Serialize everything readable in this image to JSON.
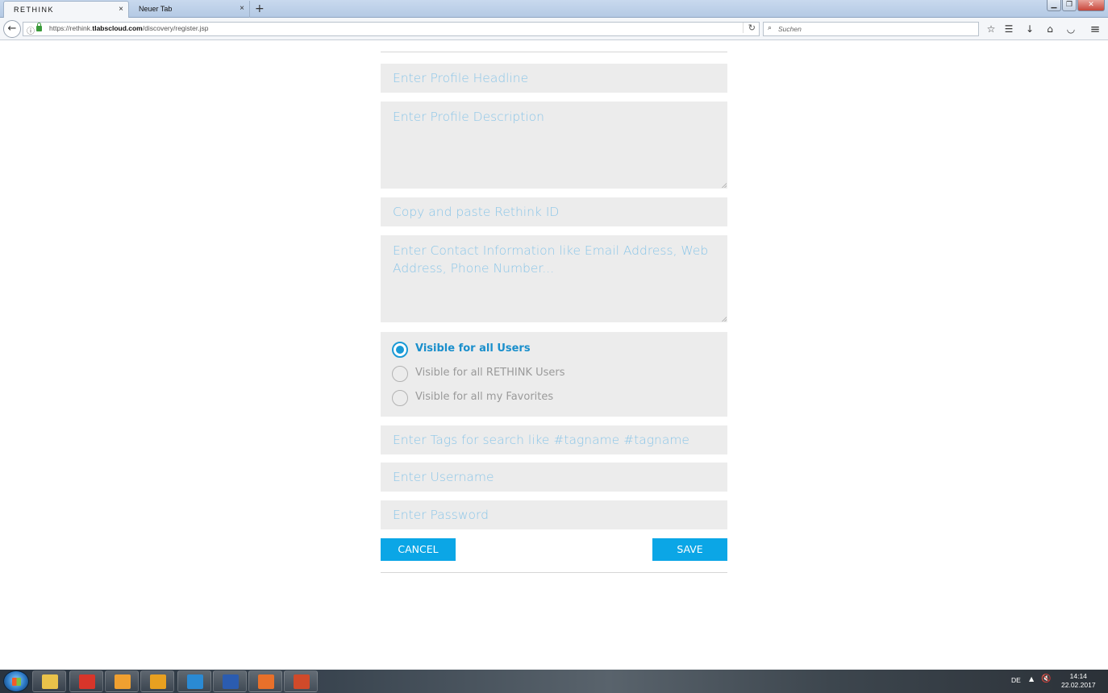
{
  "browser": {
    "tabs": [
      {
        "label": "RETHINK",
        "close": "×"
      },
      {
        "label": "Neuer Tab",
        "close": "×"
      }
    ],
    "new_tab": "+",
    "window_buttons": {
      "minimize": "▁",
      "maximize": "❐",
      "close": "✕"
    },
    "url_prefix": "https://rethink.",
    "url_domain": "tlabscloud.com",
    "url_path": "/discovery/register.jsp",
    "search_placeholder": "Suchen",
    "icons": {
      "back": "←",
      "info": "ⓘ",
      "reload": "↻",
      "search": "⌕",
      "bookmark": "☆",
      "reading_list": "☰",
      "download": "↓",
      "home": "⌂",
      "pocket": "◡",
      "menu": "≡"
    }
  },
  "form": {
    "headline_placeholder": "Enter Profile Headline",
    "description_placeholder": "Enter Profile Description",
    "rethink_id_placeholder": "Copy and paste Rethink ID",
    "contact_placeholder": "Enter Contact Information like Email Address, Web Address, Phone Number...",
    "visibility_options": [
      {
        "label": "Visible for all Users",
        "checked": true
      },
      {
        "label": "Visible for all RETHINK Users",
        "checked": false
      },
      {
        "label": "Visible for all my Favorites",
        "checked": false
      }
    ],
    "tags_placeholder": "Enter Tags for search like #tagname #tagname",
    "username_placeholder": "Enter Username",
    "password_placeholder": "Enter Password",
    "cancel_label": "CANCEL",
    "save_label": "SAVE"
  },
  "taskbar": {
    "language": "DE",
    "tray_arrow": "▲",
    "sound_icon": "🔇",
    "time": "14:14",
    "date": "22.02.2017",
    "apps": [
      {
        "name": "explorer",
        "color": "#e9c24a"
      },
      {
        "name": "network-app",
        "color": "#d8352a"
      },
      {
        "name": "media-player",
        "color": "#f0a030"
      },
      {
        "name": "outlook",
        "color": "#e8a020"
      },
      {
        "name": "lync",
        "color": "#2a8ad4"
      },
      {
        "name": "word",
        "color": "#2b5cb0"
      },
      {
        "name": "firefox",
        "color": "#e8702a"
      },
      {
        "name": "powerpoint",
        "color": "#d04a2a"
      }
    ]
  },
  "colors": {
    "accent": "#0ba6e6",
    "field_bg": "#ececec",
    "placeholder": "#8cc6e8"
  }
}
